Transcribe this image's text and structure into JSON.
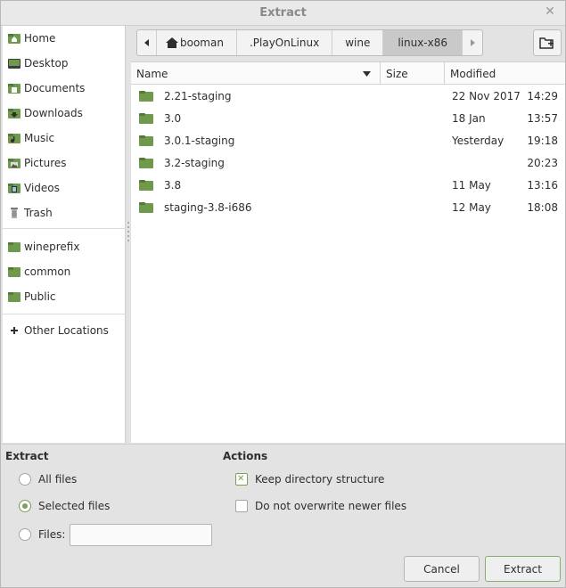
{
  "window": {
    "title": "Extract"
  },
  "sidebar": {
    "items": [
      {
        "label": "Home",
        "icon": "home-icon"
      },
      {
        "label": "Desktop",
        "icon": "desktop-icon"
      },
      {
        "label": "Documents",
        "icon": "documents-icon"
      },
      {
        "label": "Downloads",
        "icon": "downloads-icon"
      },
      {
        "label": "Music",
        "icon": "music-icon"
      },
      {
        "label": "Pictures",
        "icon": "pictures-icon"
      },
      {
        "label": "Videos",
        "icon": "videos-icon"
      },
      {
        "label": "Trash",
        "icon": "trash-icon"
      },
      {
        "label": "wineprefix",
        "icon": "folder-icon"
      },
      {
        "label": "common",
        "icon": "folder-icon"
      },
      {
        "label": "Public",
        "icon": "folder-icon"
      },
      {
        "label": "Other Locations",
        "icon": "plus-icon"
      }
    ]
  },
  "path": {
    "crumbs": [
      "booman",
      ".PlayOnLinux",
      "wine",
      "linux-x86"
    ],
    "active": "linux-x86"
  },
  "columns": {
    "name": "Name",
    "size": "Size",
    "modified": "Modified"
  },
  "files": [
    {
      "name": "2.21-staging",
      "date": "22 Nov 2017",
      "time": "14:29"
    },
    {
      "name": "3.0",
      "date": "18 Jan",
      "time": "13:57"
    },
    {
      "name": "3.0.1-staging",
      "date": "Yesterday",
      "time": "19:18"
    },
    {
      "name": "3.2-staging",
      "date": "",
      "time": "20:23"
    },
    {
      "name": "3.8",
      "date": "11 May",
      "time": "13:16"
    },
    {
      "name": "staging-3.8-i686",
      "date": "12 May",
      "time": "18:08"
    }
  ],
  "extract": {
    "heading": "Extract",
    "all_files": "All files",
    "selected_files": "Selected files",
    "files_label": "Files:",
    "files_value": "",
    "selected": "selected_files"
  },
  "actions": {
    "heading": "Actions",
    "keep_structure": "Keep directory structure",
    "keep_structure_checked": true,
    "no_overwrite": "Do not overwrite newer files",
    "no_overwrite_checked": false
  },
  "buttons": {
    "cancel": "Cancel",
    "extract": "Extract"
  },
  "colors": {
    "accent": "#7ba05b",
    "folder": "#6f9a4e"
  }
}
